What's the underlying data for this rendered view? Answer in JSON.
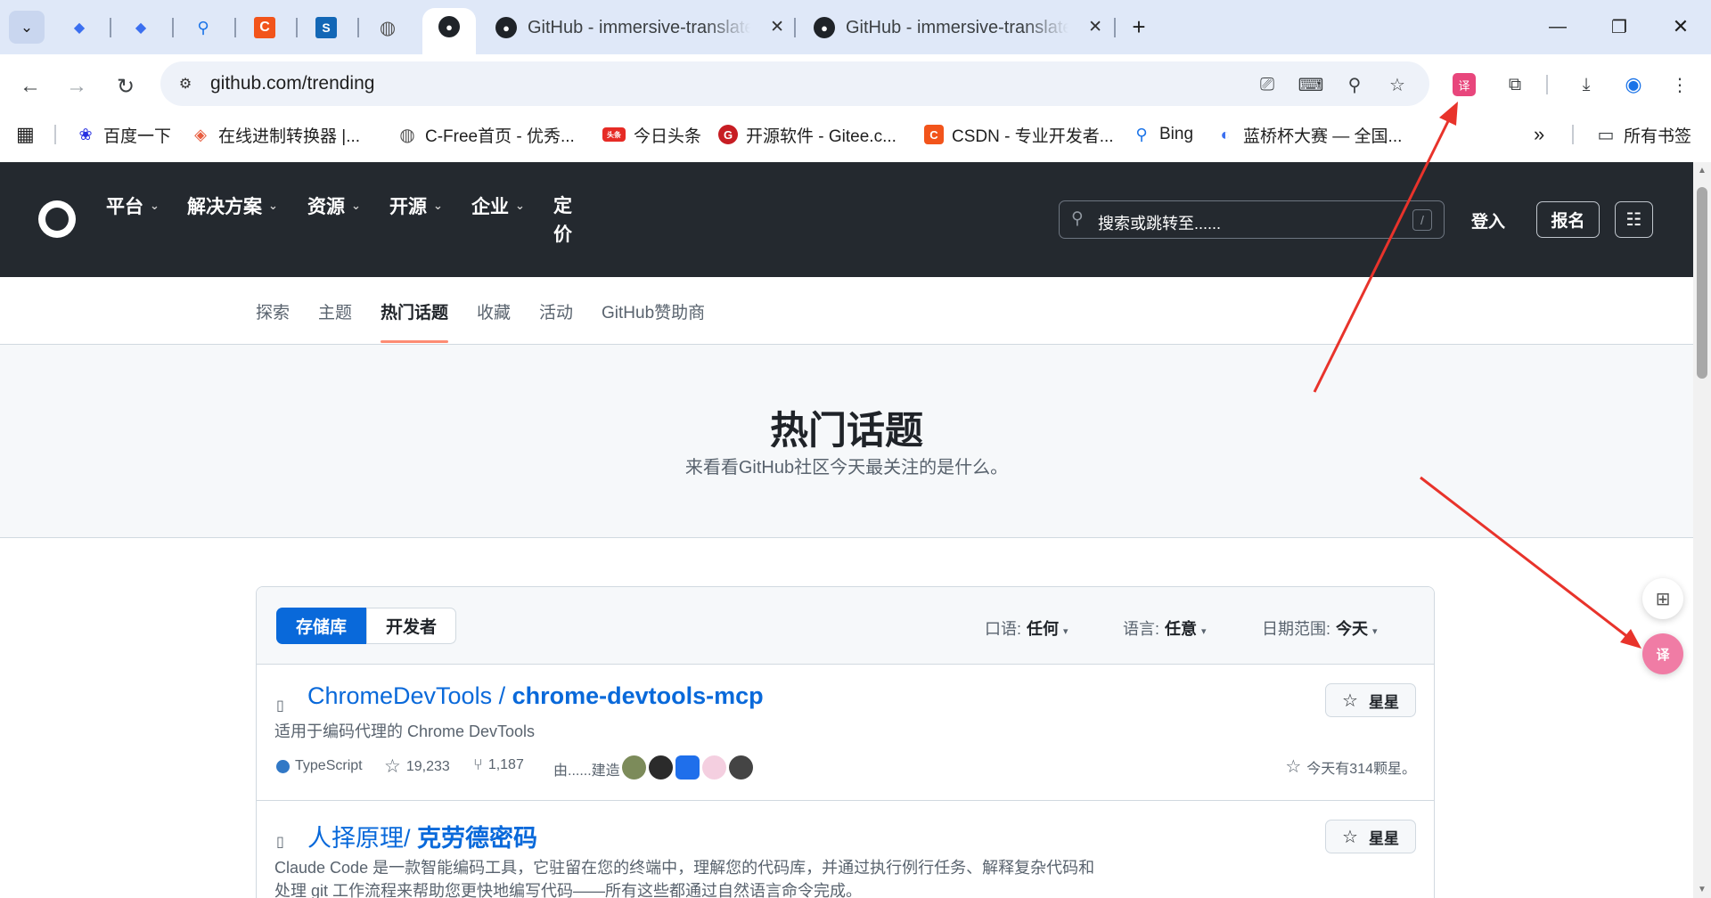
{
  "browser": {
    "tabs": [
      {
        "title": "GitHub - immersive-translate"
      },
      {
        "title": "GitHub - immersive-translate"
      }
    ],
    "address": "github.com/trending",
    "bookmarks": [
      {
        "label": "百度一下"
      },
      {
        "label": "在线进制转换器 |..."
      },
      {
        "label": "C-Free首页 - 优秀..."
      },
      {
        "label": "今日头条"
      },
      {
        "label": "开源软件 - Gitee.c..."
      },
      {
        "label": "CSDN - 专业开发者..."
      },
      {
        "label": "Bing"
      },
      {
        "label": "蓝桥杯大赛 — 全国..."
      }
    ],
    "all_bookmarks": "所有书签",
    "overflow": "»"
  },
  "github": {
    "nav": [
      "平台",
      "解决方案",
      "资源",
      "开源",
      "企业"
    ],
    "pricing": [
      "定",
      "价"
    ],
    "search_placeholder": "搜索或跳转至......",
    "search_key": "/",
    "signin": "登入",
    "signup": "报名",
    "subnav": [
      "探索",
      "主题",
      "热门话题",
      "收藏",
      "活动",
      "GitHub赞助商"
    ],
    "hero_title": "热门话题",
    "hero_subtitle": "来看看GitHub社区今天最关注的是什么。",
    "segments": [
      "存储库",
      "开发者"
    ],
    "filters": [
      {
        "label": "口语:",
        "value": "任何"
      },
      {
        "label": "语言:",
        "value": "任意"
      },
      {
        "label": "日期范围:",
        "value": "今天"
      }
    ],
    "repos": [
      {
        "owner": "ChromeDevTools / ",
        "name": "chrome-devtools-mcp",
        "description": "适用于编码代理的 Chrome DevTools",
        "language": "TypeScript",
        "language_color": "#3178c6",
        "stars": "19,233",
        "forks": "1,187",
        "built_by": "由......建造",
        "stars_today": "今天有314颗星。",
        "star_label": "星星"
      },
      {
        "owner": "人择原理/ ",
        "name": "克劳德密码",
        "description": "Claude Code 是一款智能编码工具，它驻留在您的终端中，理解您的代码库，并通过执行例行任务、解释复杂代码和处理 git 工作流程来帮助您更快地编写代码——所有这些都通过自然语言命令完成。",
        "star_label": "星星"
      }
    ]
  }
}
